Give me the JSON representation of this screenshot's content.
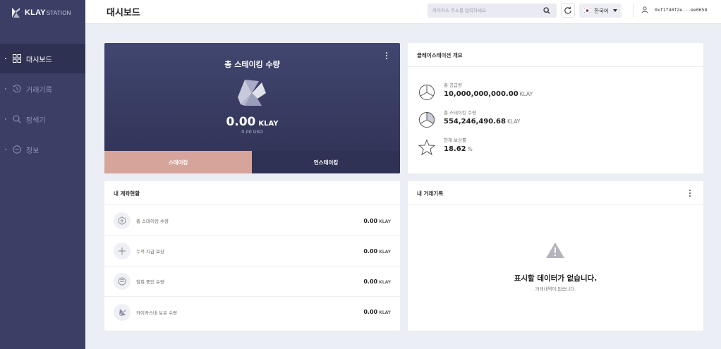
{
  "brand": {
    "name": "KLAY",
    "suffix": "STATION"
  },
  "sidebar": {
    "items": [
      {
        "label": "대시보드",
        "icon": "dashboard-icon",
        "active": true
      },
      {
        "label": "거래기록",
        "icon": "history-icon",
        "active": false
      },
      {
        "label": "탐색기",
        "icon": "search-icon",
        "active": false
      },
      {
        "label": "정보",
        "icon": "info-icon",
        "active": false
      }
    ]
  },
  "header": {
    "title": "대시보드",
    "search_placeholder": "카이카스 주소를 입력하세요",
    "language": "한국어",
    "account_address": "0xf1f40f2e...ee0658"
  },
  "staking": {
    "title": "총 스테이킹 수량",
    "amount": "0.00",
    "unit": "KLAY",
    "usd": "0.00 USD",
    "stake_label": "스테이킹",
    "unstake_label": "언스테이킹"
  },
  "overview": {
    "title": "클레이스테이션 개요",
    "items": [
      {
        "label": "총 공급량",
        "value": "10,000,000,000.00",
        "unit": "KLAY",
        "icon": "pie-chart-icon"
      },
      {
        "label": "총 스테이킹 수량",
        "value": "554,246,490.68",
        "unit": "KLAY",
        "icon": "pie-chart-filled-icon"
      },
      {
        "label": "현재 보상률",
        "value": "18.62",
        "unit": "%",
        "icon": "star-icon"
      }
    ]
  },
  "account": {
    "title": "내 계좌현황",
    "rows": [
      {
        "label": "총 스테이킹 수량",
        "value": "0.00",
        "unit": "KLAY",
        "icon": "stake-icon"
      },
      {
        "label": "누적 지급 보상",
        "value": "0.00",
        "unit": "KLAY",
        "icon": "plus-icon"
      },
      {
        "label": "철회 중인 수량",
        "value": "0.00",
        "unit": "KLAY",
        "icon": "withdraw-icon"
      },
      {
        "label": "카이카스내 보유 수량",
        "value": "0.00",
        "unit": "KLAY",
        "icon": "klay-icon"
      }
    ]
  },
  "transactions": {
    "title": "내 거래기록",
    "empty_title": "표시할 데이터가 없습니다.",
    "empty_sub": "거래내역이 없습니다."
  },
  "colors": {
    "sidebar": "#3b3f66",
    "sidebar_active": "#2e3152",
    "stake_button": "#d6a49b",
    "unstake_button": "#2f3254",
    "background": "#eceef5"
  }
}
